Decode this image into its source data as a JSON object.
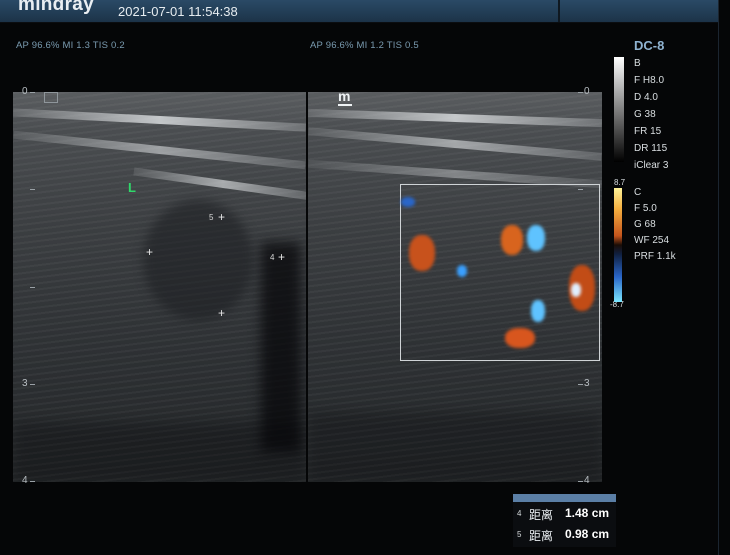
{
  "topbar": {
    "brand": "mindray",
    "datetime": "2021-07-01   11:54:38"
  },
  "left_image": {
    "params": "AP 96.6%  MI 1.3  TIS 0.2",
    "orientation_label": "L",
    "markers": [
      "5",
      "4"
    ]
  },
  "right_image": {
    "params": "AP 96.6%  MI 1.2  TIS 0.5",
    "probe_mark": "m"
  },
  "depth_scale": {
    "labels": [
      "0",
      "3",
      "4"
    ]
  },
  "settings_panel": {
    "probe": "DC-8",
    "bmode": {
      "title": "B",
      "items": [
        "F H8.0",
        "D 4.0",
        "G 38",
        "FR 15",
        "DR 115",
        "iClear 3"
      ]
    },
    "color": {
      "title": "C",
      "scale_top": "8.7",
      "scale_bottom": "-8.7",
      "items": [
        "F 5.0",
        "G 68",
        "WF 254",
        "PRF 1.1k"
      ]
    }
  },
  "measurements": [
    {
      "index": "4",
      "label": "距离",
      "value": "1.48 cm"
    },
    {
      "index": "5",
      "label": "距离",
      "value": "0.98 cm"
    }
  ],
  "colors": {
    "accent_blue": "#5b7fa6",
    "header_blue": "#2a4a66",
    "doppler_red": "#d8561e",
    "doppler_blue": "#3aa0ff",
    "marker_green": "#2fd86a"
  }
}
